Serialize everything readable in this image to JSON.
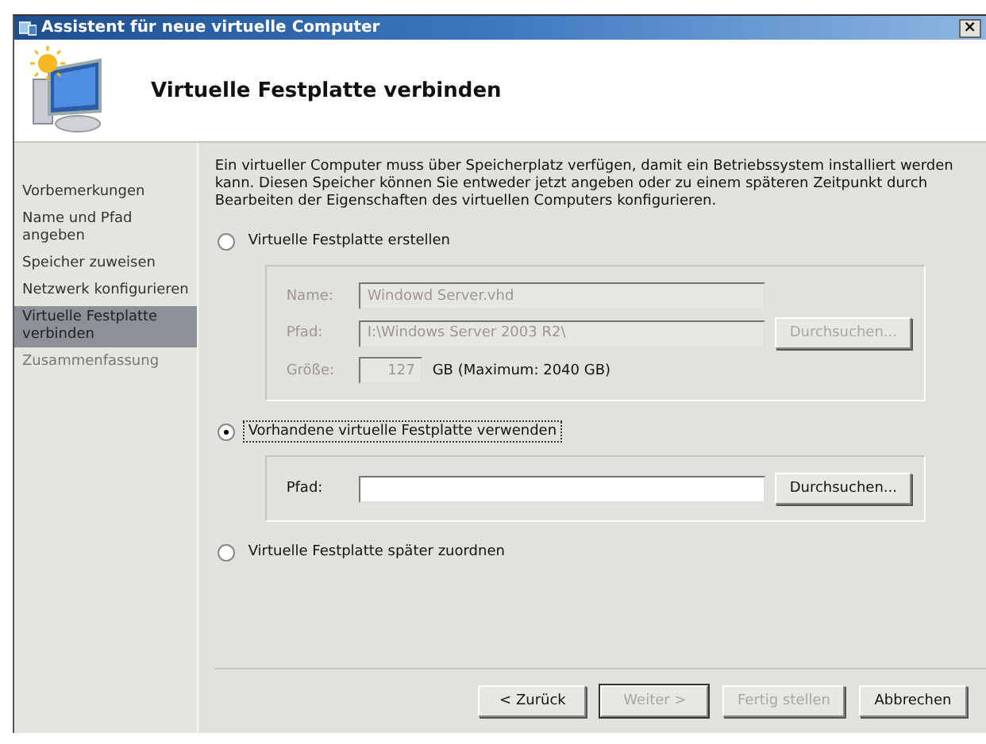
{
  "window": {
    "title": "Assistent für neue virtuelle Computer",
    "close": "×"
  },
  "header": {
    "title": "Virtuelle Festplatte verbinden"
  },
  "steps": [
    {
      "label": "Vorbemerkungen",
      "selected": false
    },
    {
      "label": "Name und Pfad angeben",
      "selected": false
    },
    {
      "label": "Speicher zuweisen",
      "selected": false
    },
    {
      "label": "Netzwerk konfigurieren",
      "selected": false
    },
    {
      "label": "Virtuelle Festplatte verbinden",
      "selected": true
    },
    {
      "label": "Zusammenfassung",
      "selected": false
    }
  ],
  "description": "Ein virtueller Computer muss über Speicherplatz verfügen, damit ein Betriebssystem installiert werden kann. Diesen Speicher können Sie entweder jetzt angeben oder zu einem späteren Zeitpunkt durch Bearbeiten der Eigenschaften des virtuellen Computers konfigurieren.",
  "options": [
    {
      "label": "Virtuelle Festplatte erstellen",
      "selected": false,
      "focused": false,
      "fields": [
        {
          "kind": "text",
          "label": "Name:",
          "value": "Windowd Server.vhd",
          "disabled": true
        },
        {
          "kind": "browse",
          "label": "Pfad:",
          "value": "I:\\Windows Server 2003 R2\\",
          "button": "Durchsuchen...",
          "disabled": true
        },
        {
          "kind": "size",
          "label": "Größe:",
          "value": "127",
          "note": "GB (Maximum: 2040 GB)",
          "disabled": true
        }
      ]
    },
    {
      "label": "Vorhandene virtuelle Festplatte verwenden",
      "selected": true,
      "focused": true,
      "fields": [
        {
          "kind": "browse",
          "label": "Pfad:",
          "button": "Durchsuchen...",
          "disabled": false
        }
      ]
    },
    {
      "label": "Virtuelle Festplatte später zuordnen",
      "selected": false,
      "focused": false
    }
  ],
  "buttons": [
    {
      "label": "< Zurück",
      "disabled": false,
      "default": false
    },
    {
      "label": "Weiter >",
      "disabled": true,
      "default": true
    },
    {
      "label": "Fertig stellen",
      "disabled": true,
      "default": false
    },
    {
      "label": "Abbrechen",
      "disabled": false,
      "default": false
    }
  ]
}
